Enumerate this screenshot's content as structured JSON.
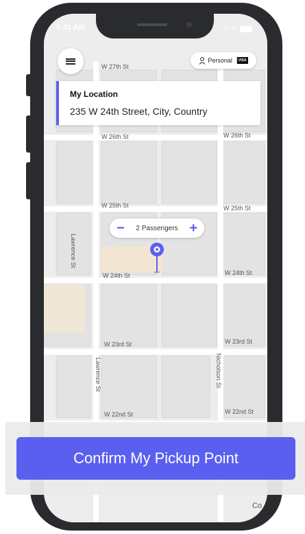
{
  "status_bar": {
    "time": "9:41 AM",
    "icons": ".ıl ᯤ"
  },
  "map": {
    "streets": [
      "W 27th St",
      "W 26th St",
      "W 26th St",
      "W 25th St",
      "W 25th St",
      "W 24th St",
      "W 24th St",
      "W 23rd St",
      "W 23rd St",
      "W 22nd St",
      "W 22nd St",
      "Lawrence St",
      "Lawrence St",
      "Nicholson St"
    ],
    "corner_text": "Co"
  },
  "header": {
    "account_label": "Personal",
    "card_brand": "VISA"
  },
  "location_card": {
    "title": "My Location",
    "address": "235 W 24th Street, City, Country"
  },
  "passengers": {
    "label": "2 Passengers",
    "minus": "−",
    "plus": "+"
  },
  "confirm": {
    "label": "Confirm My Pickup Point"
  },
  "colors": {
    "accent": "#5b5ff0",
    "phone_frame": "#2a2b2e"
  },
  "icons": [
    "menu-icon",
    "person-icon",
    "visa-card-icon",
    "location-pin-icon",
    "minus-icon",
    "plus-icon"
  ]
}
